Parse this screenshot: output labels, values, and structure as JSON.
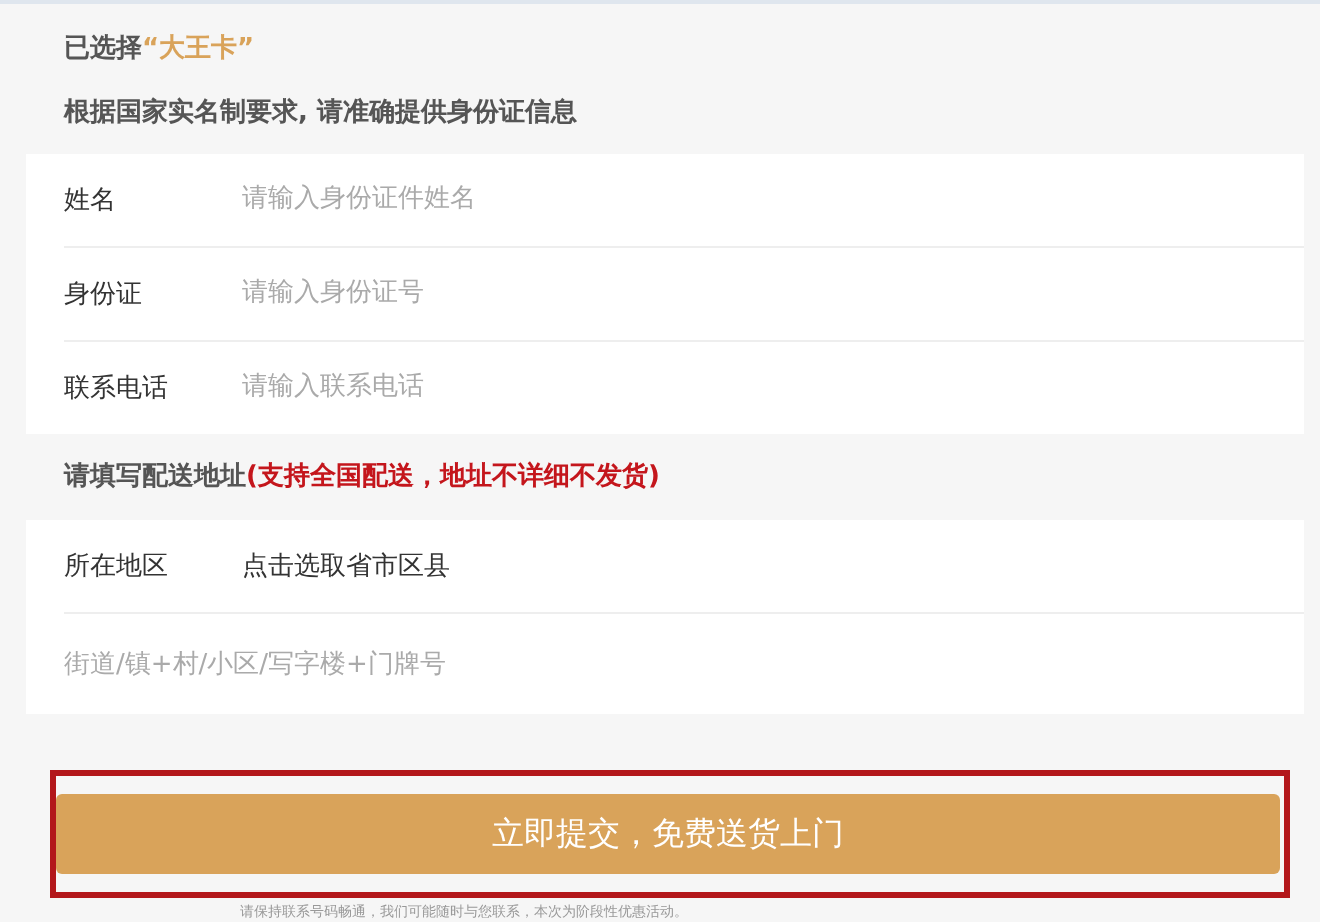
{
  "selection": {
    "prefix": "已选择",
    "product": "“大王卡”"
  },
  "id_notice": "根据国家实名制要求, 请准确提供身份证信息",
  "id_fields": [
    {
      "label": "姓名",
      "placeholder": "请输入身份证件姓名"
    },
    {
      "label": "身份证",
      "placeholder": "请输入身份证号"
    },
    {
      "label": "联系电话",
      "placeholder": "请输入联系电话"
    }
  ],
  "address_heading": {
    "text": "请填写配送地址",
    "warning": "(支持全国配送，地址不详细不发货)"
  },
  "address_fields": [
    {
      "kind": "picker",
      "label": "所在地区",
      "value": "点击选取省市区县"
    },
    {
      "kind": "input",
      "placeholder": "街道/镇+村/小区/写字楼+门牌号"
    }
  ],
  "submit_button": "立即提交，免费送货上门",
  "footnote": "请保持联系号码畅通，我们可能随时与您联系，本次为阶段性优惠活动。"
}
